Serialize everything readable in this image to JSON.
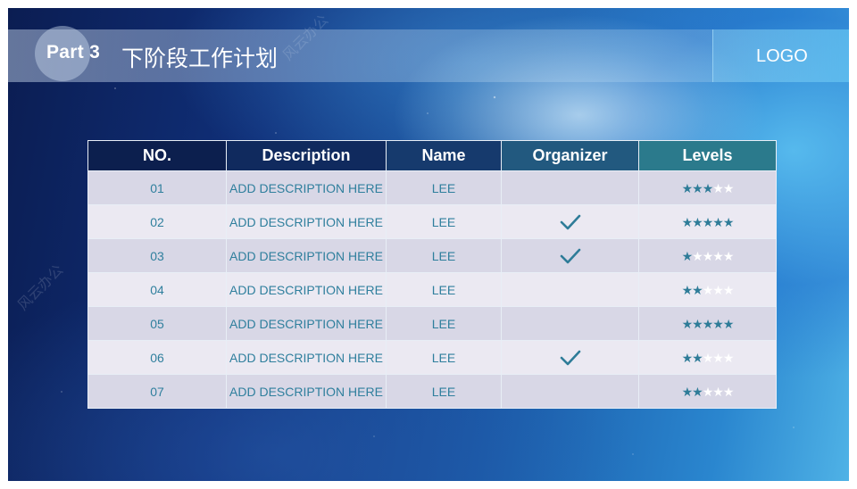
{
  "header": {
    "part_label": "Part 3",
    "title": "下阶段工作计划",
    "logo": "LOGO"
  },
  "watermark": "风云办公",
  "colors": {
    "accent": "#2e7c98",
    "header_dark": "#0c1f4e",
    "header_teal": "#2b7a8c",
    "row_odd": "#d8d7e6",
    "row_even": "#ebe9f2"
  },
  "table": {
    "headers": [
      "NO.",
      "Description",
      "Name",
      "Organizer",
      "Levels"
    ],
    "max_level": 5,
    "rows": [
      {
        "no": "01",
        "description": "ADD DESCRIPTION HERE",
        "name": "LEE",
        "organizer": false,
        "level": 3
      },
      {
        "no": "02",
        "description": "ADD DESCRIPTION HERE",
        "name": "LEE",
        "organizer": true,
        "level": 5
      },
      {
        "no": "03",
        "description": "ADD DESCRIPTION HERE",
        "name": "LEE",
        "organizer": true,
        "level": 1
      },
      {
        "no": "04",
        "description": "ADD DESCRIPTION HERE",
        "name": "LEE",
        "organizer": false,
        "level": 2
      },
      {
        "no": "05",
        "description": "ADD DESCRIPTION HERE",
        "name": "LEE",
        "organizer": false,
        "level": 5
      },
      {
        "no": "06",
        "description": "ADD DESCRIPTION HERE",
        "name": "LEE",
        "organizer": true,
        "level": 2
      },
      {
        "no": "07",
        "description": "ADD DESCRIPTION HERE",
        "name": "LEE",
        "organizer": false,
        "level": 2
      }
    ]
  }
}
